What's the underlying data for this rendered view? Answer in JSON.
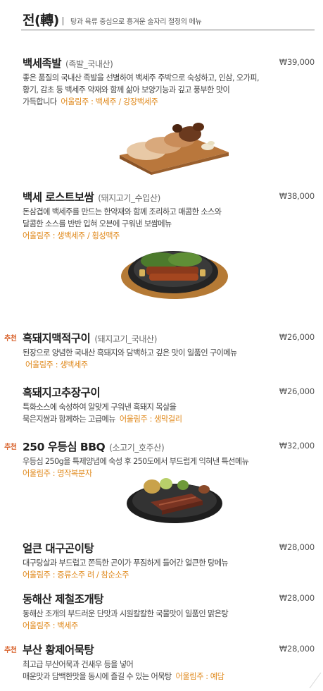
{
  "header": {
    "title": "전(轉)",
    "subtitle": "탕과 육류 중심으로 흥겨운 술자리 절정의 메뉴"
  },
  "items": [
    {
      "name": "백세족발",
      "origin": "(족발_국내산)",
      "price": "₩39,000",
      "desc_lines": [
        "좋은 품질의 국내산 족발을 선별하여 백세주 주박으로 숙성하고, 인삼, 오가피,",
        "황기, 감초 등 백세주 약재와 함께 삶아 보양기능과 깊고 풍부한 맛이"
      ],
      "last_line": "가득합니다",
      "pairing": "어울림주 : 백세주 / 강장백세주"
    },
    {
      "name": "백세 로스트보쌈",
      "origin": "(돼지고기_수입산)",
      "price": "₩38,000",
      "desc_lines": [
        "돈삼겹에 백세주를 만드는 한약재와 함께 조리하고 매콤한 소스와",
        "달콤한 소스를 반반 입혀 오븐에 구워낸 보쌈메뉴"
      ],
      "last_line": "",
      "pairing": "어울림주 : 생백세주 / 횡성맥주"
    },
    {
      "badge": "추천",
      "name": "흑돼지맥적구이",
      "origin": "(돼지고기_국내산)",
      "price": "₩26,000",
      "desc_lines": [
        "된장으로 양념한 국내산 흑돼지와 담백하고 깊은 맛이 일품인 구이메뉴"
      ],
      "last_line": "",
      "pairing": "어울림주 : 생백세주"
    },
    {
      "name": "흑돼지고추장구이",
      "origin": "",
      "price": "₩26,000",
      "desc_lines": [
        "특화소스에 숙성하여 알맞게 구워낸 흑돼지 목살을"
      ],
      "last_line": "묵은지쌈과 함께하는 고급메뉴",
      "pairing": "어울림주 : 생막걸리"
    },
    {
      "badge": "추천",
      "name": "250 우등심 BBQ",
      "origin": "(소고기_호주산)",
      "price": "₩32,000",
      "desc_lines": [
        "우등심 250g을 특제양념에 숙성 후 250도에서 부드럽게 익혀낸 특선메뉴"
      ],
      "last_line": "",
      "pairing": "어울림주 : 명작복분자"
    },
    {
      "name": "얼큰 대구곤이탕",
      "origin": "",
      "price": "₩28,000",
      "desc_lines": [
        "대구탕살과 부드럽고 쫀득한 곤이가 푸짐하게 들어간 얼큰한 탕메뉴"
      ],
      "last_line": "",
      "pairing": "어울림주 : 증류소주 려 / 참순소주"
    },
    {
      "name": "동해산 제철조개탕",
      "origin": "",
      "price": "₩28,000",
      "desc_lines": [
        "동해산 조개의 부드러운 단맛과 시원칼칼한 국물맛이 일품인 맑은탕"
      ],
      "last_line": "",
      "pairing": "어울림주 : 백세주"
    },
    {
      "badge": "추천",
      "name": "부산 황제어묵탕",
      "origin": "",
      "price": "₩28,000",
      "desc_lines": [
        "최고급 부산어묵과 건새우 등을 넣어"
      ],
      "last_line": "매운맛과 담백한맛을 동시에 즐길 수 있는 어묵탕",
      "pairing": "어울림주 : 예담"
    }
  ]
}
